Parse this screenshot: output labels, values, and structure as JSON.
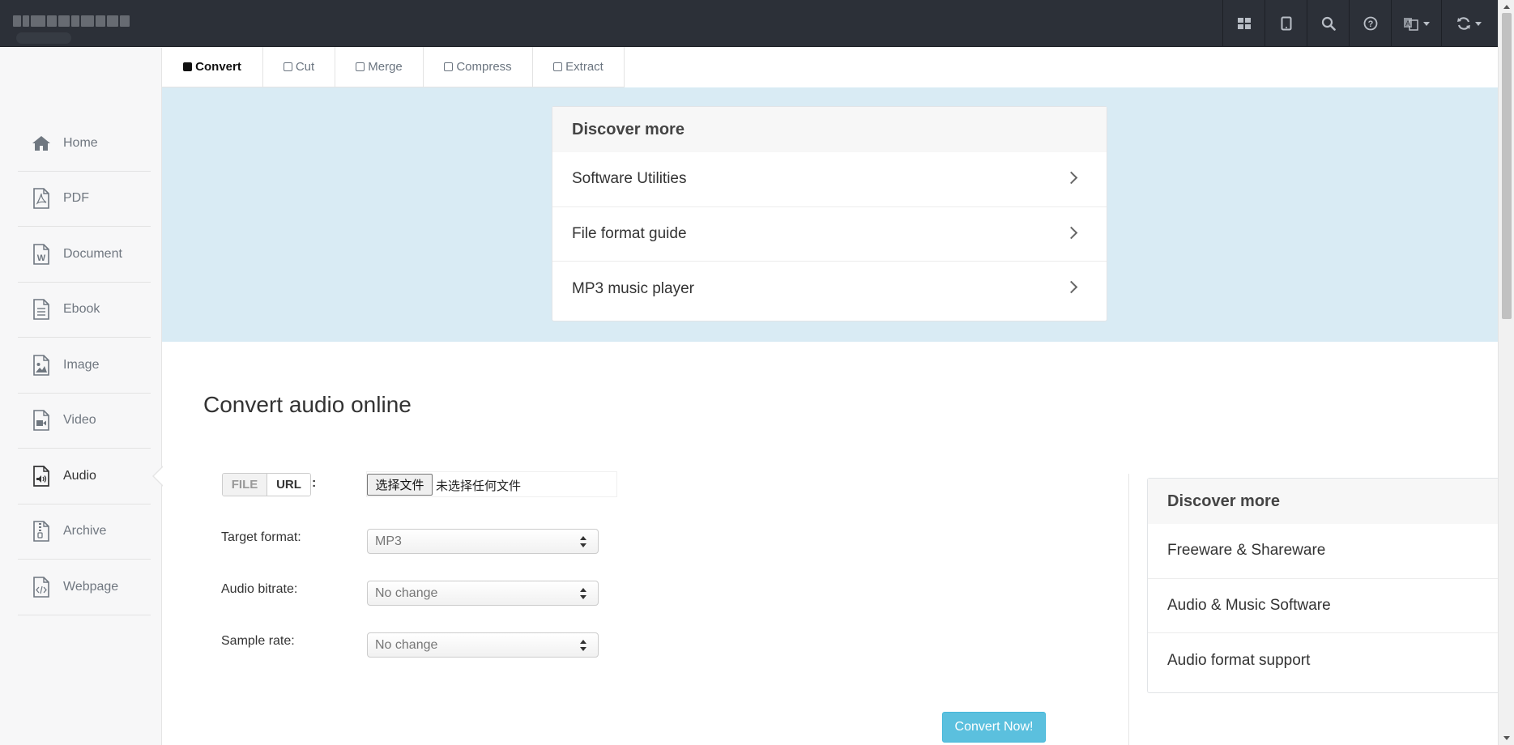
{
  "topbar": {
    "icons": [
      "grid-icon",
      "tablet-icon",
      "search-icon",
      "help-icon",
      "language-icon",
      "refresh-icon"
    ]
  },
  "tabs": [
    {
      "label": "Convert",
      "active": true
    },
    {
      "label": "Cut",
      "active": false
    },
    {
      "label": "Merge",
      "active": false
    },
    {
      "label": "Compress",
      "active": false
    },
    {
      "label": "Extract",
      "active": false
    }
  ],
  "sidebar": {
    "items": [
      {
        "label": "Home",
        "icon": "home-icon"
      },
      {
        "label": "PDF",
        "icon": "pdf-file-icon"
      },
      {
        "label": "Document",
        "icon": "word-file-icon"
      },
      {
        "label": "Ebook",
        "icon": "ebook-file-icon"
      },
      {
        "label": "Image",
        "icon": "image-file-icon"
      },
      {
        "label": "Video",
        "icon": "video-file-icon"
      },
      {
        "label": "Audio",
        "icon": "audio-file-icon",
        "active": true
      },
      {
        "label": "Archive",
        "icon": "archive-file-icon"
      },
      {
        "label": "Webpage",
        "icon": "code-file-icon"
      }
    ]
  },
  "discover_top": {
    "heading": "Discover more",
    "links": [
      "Software Utilities",
      "File format guide",
      "MP3 music player"
    ]
  },
  "main": {
    "title": "Convert audio online",
    "source": {
      "file_label": "FILE",
      "url_label": "URL",
      "colon": ":"
    },
    "file_input": {
      "button": "选择文件",
      "status": "未选择任何文件"
    },
    "fields": [
      {
        "label": "Target format:",
        "value": "MP3"
      },
      {
        "label": "Audio bitrate:",
        "value": "No change"
      },
      {
        "label": "Sample rate:",
        "value": "No change"
      }
    ],
    "convert_button": "Convert Now!"
  },
  "discover_side": {
    "heading": "Discover more",
    "links": [
      "Freeware & Shareware",
      "Audio & Music Software",
      "Audio format support"
    ]
  },
  "colors": {
    "topbar": "#2c3038",
    "band": "#d9ebf4",
    "accent": "#5bc0de"
  }
}
